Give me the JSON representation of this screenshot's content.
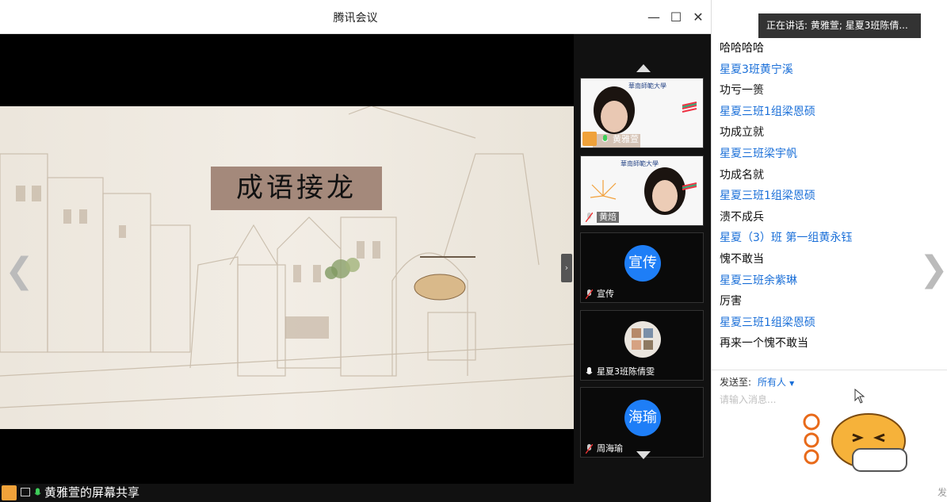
{
  "window": {
    "title": "腾讯会议"
  },
  "slide": {
    "title": "成语接龙"
  },
  "bottom_bar": {
    "share_text": "黄雅萱的屏幕共享"
  },
  "participants": [
    {
      "name": "黄雅萱",
      "type": "video"
    },
    {
      "name": "黄焙",
      "type": "video"
    },
    {
      "name": "宣传",
      "type": "avatar",
      "avatar_text": "宣传"
    },
    {
      "name": "星夏3班陈倩雯",
      "type": "photo"
    },
    {
      "name": "周海瑜",
      "type": "avatar",
      "avatar_text": "海瑜"
    }
  ],
  "chat": {
    "speaking": "正在讲话: 黄雅萱; 星夏3班陈倩...",
    "messages": [
      {
        "sender": "",
        "text": "哈哈哈哈"
      },
      {
        "sender": "星夏3班黄宁溪",
        "text": "功亏一篑"
      },
      {
        "sender": "星夏三班1组梁恩硕",
        "text": "功成立就"
      },
      {
        "sender": "星夏三班梁宇帆",
        "text": "功成名就"
      },
      {
        "sender": "星夏三班1组梁恩硕",
        "text": "溃不成兵"
      },
      {
        "sender": "星夏（3）班 第一组黄永钰",
        "text": "愧不敢当"
      },
      {
        "sender": "星夏三班余紫琳",
        "text": "厉害"
      },
      {
        "sender": "星夏三班1组梁恩硕",
        "text": "再来一个愧不敢当"
      }
    ],
    "send_to_label": "发送至:",
    "send_to_target": "所有人",
    "input_placeholder": "请输入消息...",
    "send_button": "发"
  },
  "colors": {
    "accent": "#1a6fd8",
    "avatar": "#1e7ef7"
  }
}
